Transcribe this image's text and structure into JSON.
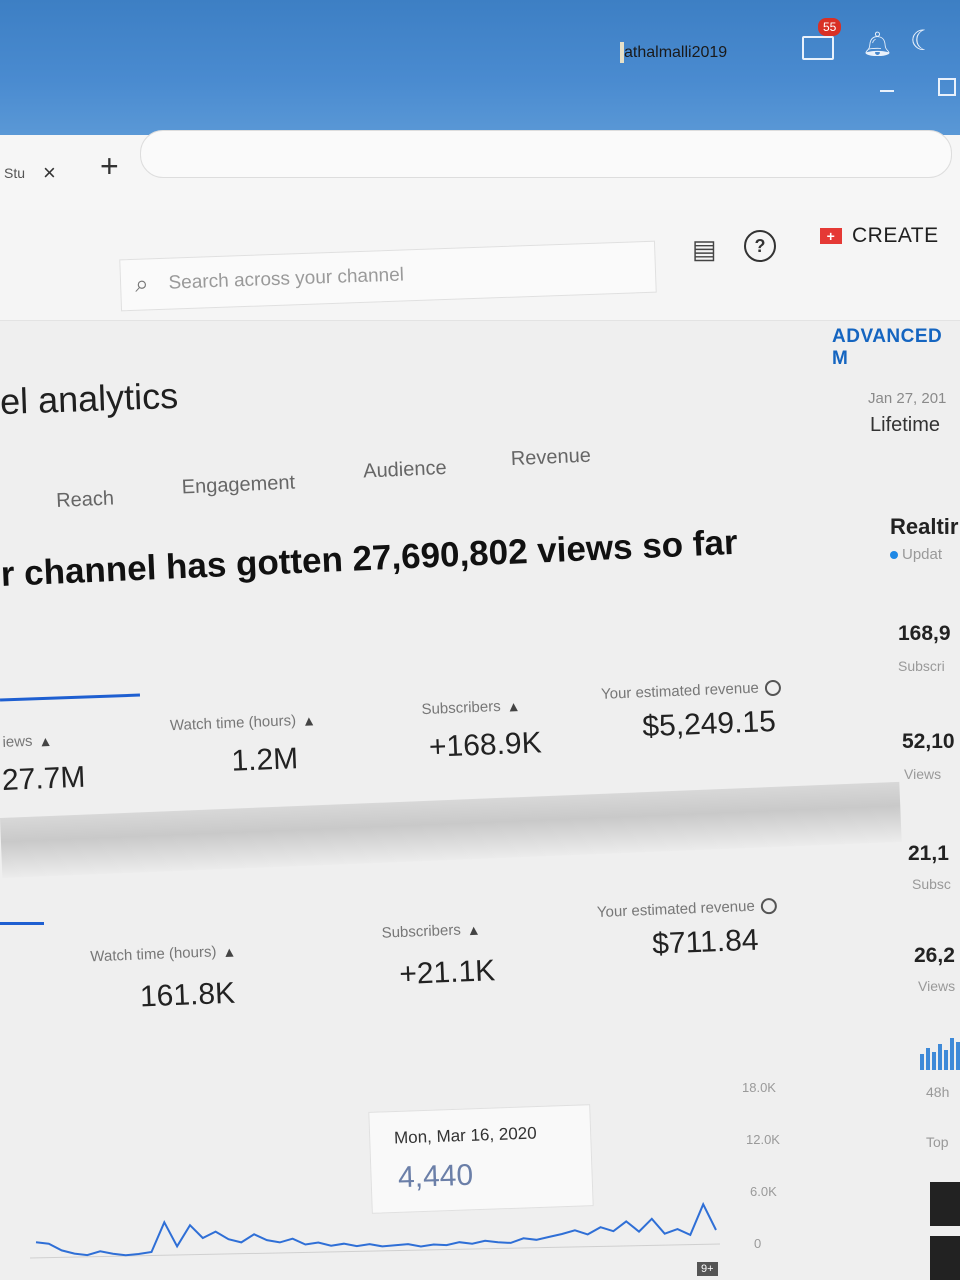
{
  "system_bar": {
    "username": "athalmalli2019",
    "notification_count": "55"
  },
  "browser": {
    "tab_label": "Stu",
    "tab_close": "×",
    "new_tab": "+"
  },
  "header": {
    "search_placeholder": "Search across your channel",
    "create_label": "CREATE"
  },
  "page": {
    "title": "el analytics",
    "advanced_link": "ADVANCED M",
    "date_range": "Jan 27, 201",
    "period": "Lifetime",
    "tabs": [
      "Reach",
      "Engagement",
      "Audience",
      "Revenue"
    ],
    "headline": "r channel has gotten 27,690,802 views so far"
  },
  "lifetime_metrics": [
    {
      "label": "iews",
      "value": "27.7M"
    },
    {
      "label": "Watch time (hours)",
      "value": "1.2M"
    },
    {
      "label": "Subscribers",
      "value": "+168.9K"
    },
    {
      "label": "Your estimated revenue",
      "value": "$5,249.15"
    }
  ],
  "period_metrics": [
    {
      "label": "Watch time (hours)",
      "value": "161.8K"
    },
    {
      "label": "Subscribers",
      "value": "+21.1K"
    },
    {
      "label": "Your estimated revenue",
      "value": "$711.84"
    }
  ],
  "realtime": {
    "title": "Realtir",
    "status": "Updat",
    "stats": [
      {
        "value": "168,9",
        "label": "Subscri"
      },
      {
        "value": "52,10",
        "label": "Views"
      },
      {
        "value": "21,1",
        "label": "Subsc"
      },
      {
        "value": "26,2",
        "label": "Views"
      }
    ],
    "hours_label": "48h",
    "top_label": "Top"
  },
  "chart_data": {
    "type": "line",
    "y_ticks": [
      "18.0K",
      "12.0K",
      "6.0K",
      "0"
    ],
    "ylim": [
      0,
      18000
    ],
    "series": [
      {
        "values": [
          3200,
          3000,
          2200,
          1800,
          1600,
          2000,
          1700,
          1500,
          1600,
          1800,
          5200,
          2400,
          4800,
          3300,
          4000,
          3100,
          2700,
          3600,
          2900,
          2600,
          3000,
          2300,
          2500,
          2100,
          2300,
          2000,
          2200,
          1900,
          2000,
          2100,
          1800,
          2000,
          1900,
          2200,
          2000,
          2300,
          2100,
          2000,
          2500,
          2300,
          2600,
          2900,
          3300,
          2800,
          3600,
          3100,
          4200,
          3000,
          4440,
          2700,
          3200,
          2500,
          6000,
          3000
        ]
      }
    ],
    "tooltip": {
      "date": "Mon, Mar 16, 2020",
      "value": "4,440"
    },
    "badge": "9+"
  }
}
